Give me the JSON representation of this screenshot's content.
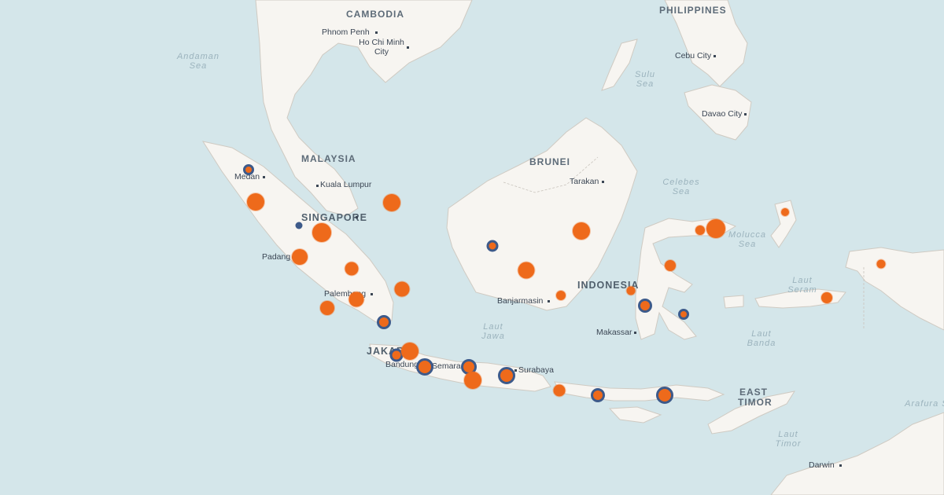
{
  "map": {
    "countries": [
      {
        "id": "cambodia",
        "label": "CAMBODIA"
      },
      {
        "id": "philippines",
        "label": "PHILIPPINES"
      },
      {
        "id": "malaysia",
        "label": "MALAYSIA"
      },
      {
        "id": "brunei",
        "label": "BRUNEI"
      },
      {
        "id": "singapore",
        "label": "SINGAPORE"
      },
      {
        "id": "indonesia",
        "label": "INDONESIA"
      },
      {
        "id": "jakarta",
        "label": "JAKARTA"
      },
      {
        "id": "east-timor",
        "label": "EAST TIMOR"
      }
    ],
    "cities": [
      {
        "id": "phnom-penh",
        "label": "Phnom Penh"
      },
      {
        "id": "ho-chi-minh",
        "label": "Ho Chi Minh City"
      },
      {
        "id": "cebu",
        "label": "Cebu City"
      },
      {
        "id": "davao",
        "label": "Davao City"
      },
      {
        "id": "medan",
        "label": "Medan"
      },
      {
        "id": "kuala-lumpur",
        "label": "Kuala Lumpur"
      },
      {
        "id": "tarakan",
        "label": "Tarakan"
      },
      {
        "id": "padang",
        "label": "Padang"
      },
      {
        "id": "palembang",
        "label": "Palembang"
      },
      {
        "id": "banjarmasin",
        "label": "Banjarmasin"
      },
      {
        "id": "makassar",
        "label": "Makassar"
      },
      {
        "id": "bandung",
        "label": "Bandung"
      },
      {
        "id": "semarang",
        "label": "Semarang"
      },
      {
        "id": "surabaya",
        "label": "Surabaya"
      },
      {
        "id": "darwin",
        "label": "Darwin"
      }
    ],
    "seas": [
      {
        "id": "andaman",
        "label": "Andaman Sea"
      },
      {
        "id": "sulu",
        "label": "Sulu Sea"
      },
      {
        "id": "celebes",
        "label": "Celebes Sea"
      },
      {
        "id": "molucca",
        "label": "Molucca Sea"
      },
      {
        "id": "seram",
        "label": "Laut Seram"
      },
      {
        "id": "banda",
        "label": "Laut Banda"
      },
      {
        "id": "jawa",
        "label": "Laut Jawa"
      },
      {
        "id": "timor",
        "label": "Laut Timor"
      },
      {
        "id": "arafura",
        "label": "Arafura Sea"
      }
    ],
    "colors": {
      "water": "#d4e6ea",
      "land": "#f7f5f1",
      "border": "#c9c4bd",
      "marker_orange": "#ee6a1b",
      "marker_ring": "#3d5a8a"
    },
    "marker_types": [
      "orange-dot",
      "ringed-dot",
      "blue-dot"
    ]
  }
}
